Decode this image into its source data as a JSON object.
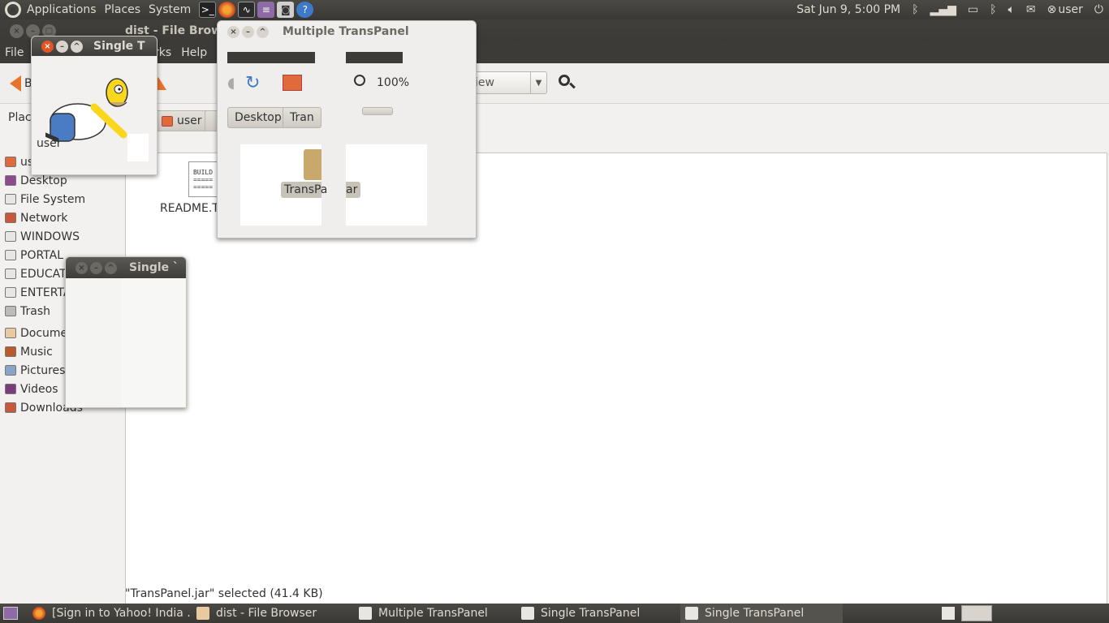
{
  "top_panel": {
    "menus": [
      "Applications",
      "Places",
      "System"
    ],
    "datetime": "Sat Jun  9,  5:00 PM",
    "user": "user"
  },
  "file_browser": {
    "title": "dist - File Browser",
    "menu_file": "File",
    "menu_bookmarks": "arks",
    "menu_help": "Help",
    "back_label": "Back",
    "forward_label": "rwar",
    "zoom": "100%",
    "view_label": "iew",
    "places_label": "Places",
    "breadcrumbs": [
      "user",
      "Desktop",
      "Tran"
    ],
    "sidebar": [
      {
        "label": "user",
        "icon": "home-icon"
      },
      {
        "label": "Desktop",
        "icon": "desktop-icon"
      },
      {
        "label": "File System",
        "icon": "drive-icon"
      },
      {
        "label": "Network",
        "icon": "network-icon"
      },
      {
        "label": "WINDOWS",
        "icon": "drive-icon"
      },
      {
        "label": "PORTAL",
        "icon": "drive-icon"
      },
      {
        "label": "EDUCATION",
        "icon": "drive-icon"
      },
      {
        "label": "ENTERTAIN",
        "icon": "drive-icon"
      },
      {
        "label": "Trash",
        "icon": "trash-icon"
      },
      {
        "label": "Documents",
        "icon": "folder-icon"
      },
      {
        "label": "Music",
        "icon": "music-folder-icon"
      },
      {
        "label": "Pictures",
        "icon": "pictures-folder-icon"
      },
      {
        "label": "Videos",
        "icon": "videos-folder-icon"
      },
      {
        "label": "Downloads",
        "icon": "downloads-folder-icon"
      }
    ],
    "files": [
      {
        "name": "README.T",
        "icon_text": "BUILD\n=====\n====="
      },
      {
        "name": "TransPa",
        "name_tail": "ar"
      }
    ],
    "status": "\"TransPanel.jar\" selected (41.4 KB)"
  },
  "overlay_windows": {
    "multiple_title": "Multiple TransPanel",
    "single1_title": "Single T",
    "single2_title": "Single `"
  },
  "taskbar": {
    "tasks": [
      {
        "label": "[Sign in to Yahoo! India ..."
      },
      {
        "label": "dist - File Browser"
      },
      {
        "label": "Multiple TransPanel"
      },
      {
        "label": "Single TransPanel"
      },
      {
        "label": "Single TransPanel"
      }
    ]
  },
  "colors": {
    "panel": "#3c3b37",
    "accent_orange": "#e8742b",
    "close_red": "#e25525"
  }
}
